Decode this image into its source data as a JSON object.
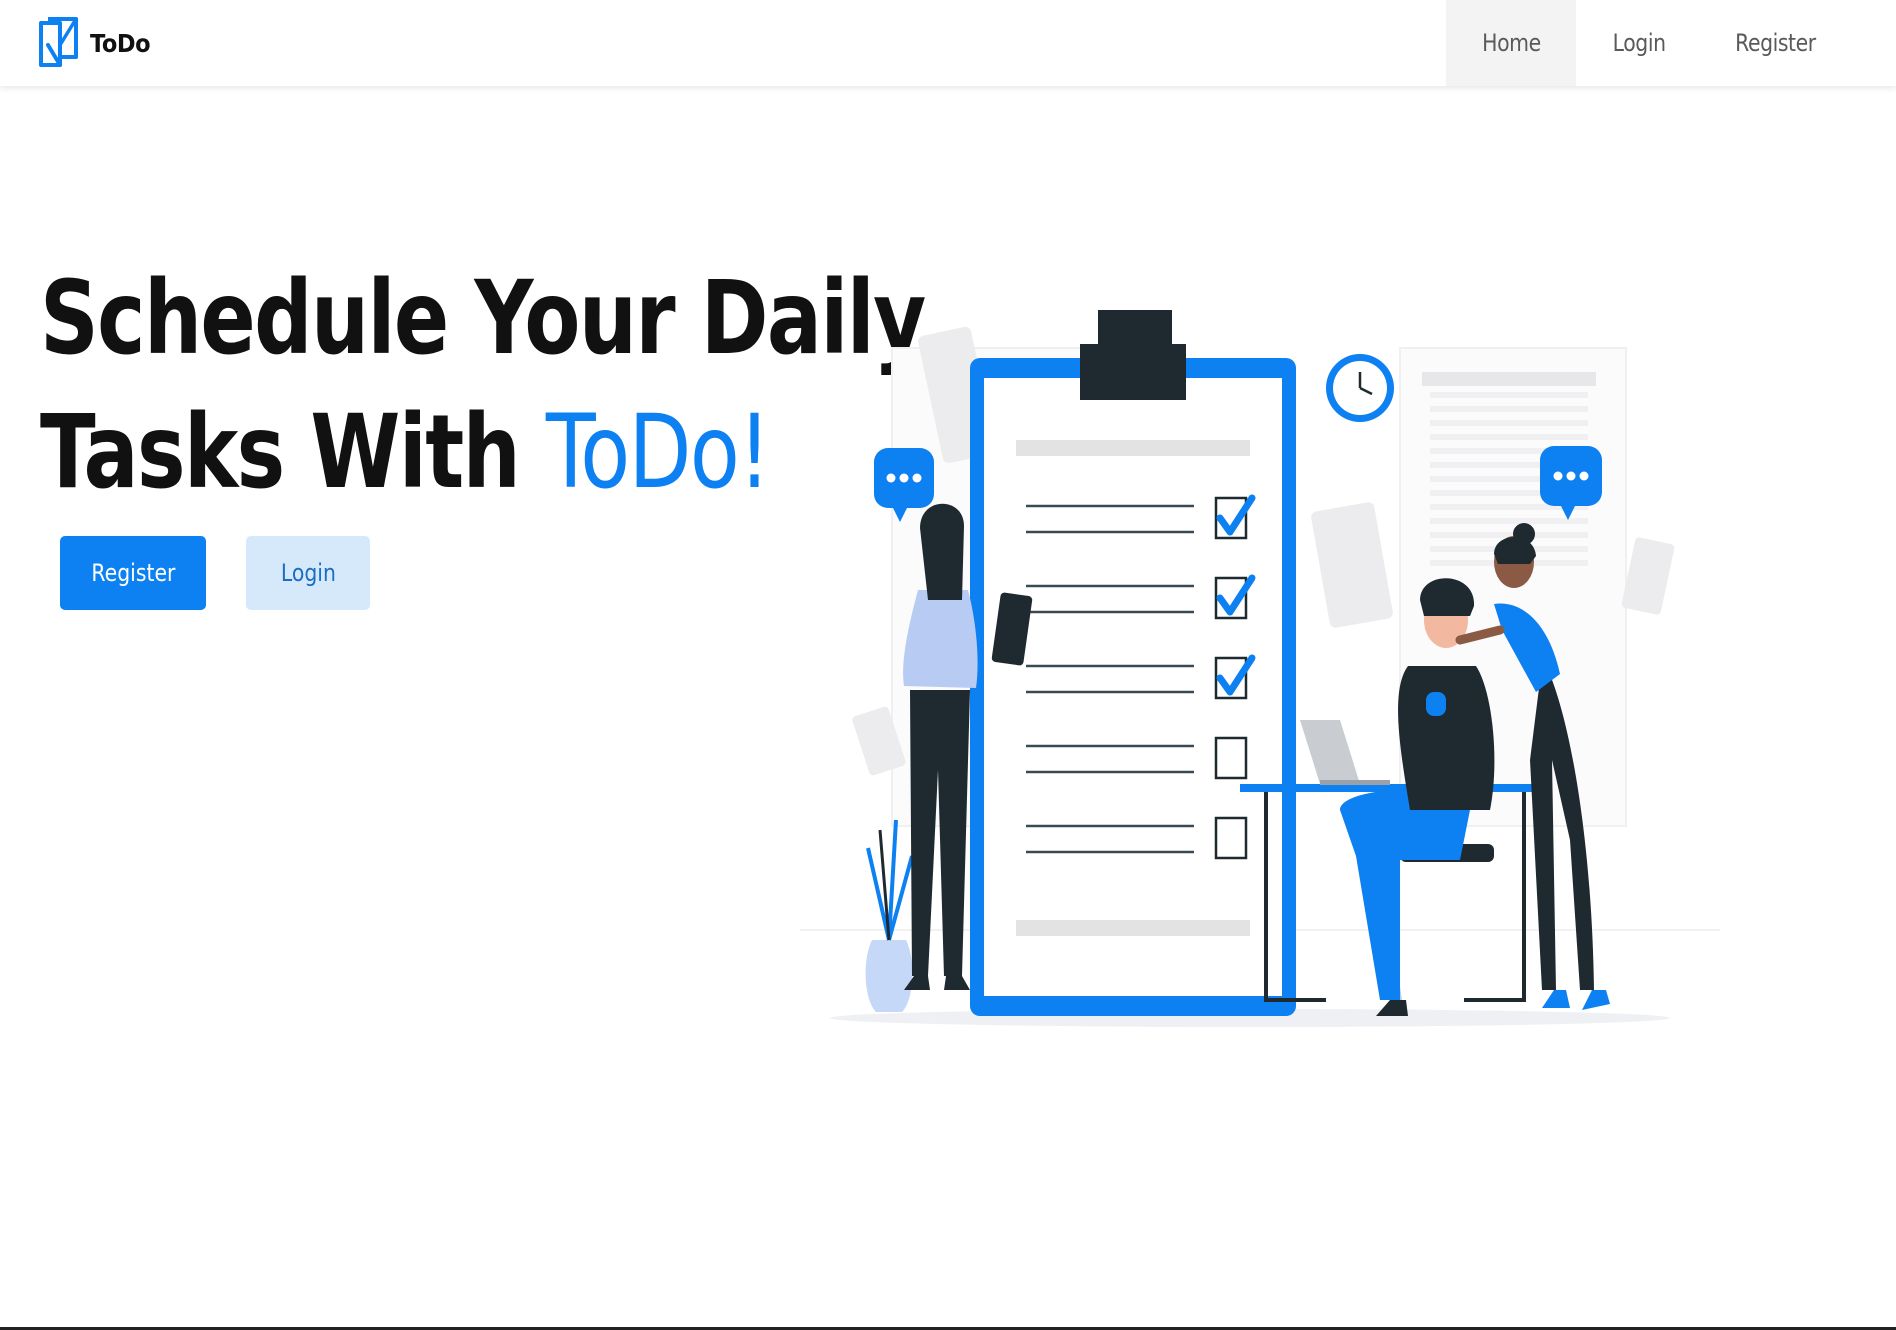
{
  "navbar": {
    "brand": {
      "logo_icon": "todo-logo-icon",
      "name": "ToDo"
    },
    "links": [
      {
        "label": "Home",
        "active": true
      },
      {
        "label": "Login",
        "active": false
      },
      {
        "label": "Register",
        "active": false
      }
    ]
  },
  "hero": {
    "title_line1": "Schedule Your Daily",
    "title_line2_prefix": "Tasks With ",
    "title_accent": "ToDo!",
    "buttons": {
      "register_label": "Register",
      "login_label": "Login"
    },
    "illustration": {
      "name": "task-checklist-illustration",
      "checklist_checked": 3,
      "checklist_total": 5
    }
  },
  "colors": {
    "accent": "#0d80f2",
    "text": "#111111",
    "secondary_button_bg": "#d6e9fb",
    "active_nav_bg": "#f3f3f3"
  }
}
